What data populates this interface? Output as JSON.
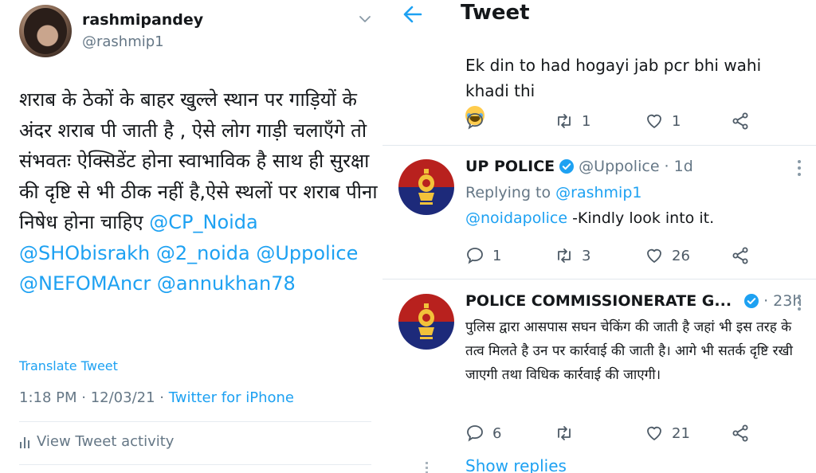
{
  "left_tweet": {
    "user": {
      "name": "rashmipandey",
      "handle": "@rashmip1"
    },
    "body_text": "शराब के ठेकों के बाहर खुल्ले स्थान पर गाड़ियों के अंदर शराब पी जाती है , ऐसे लोग गाड़ी चलाएँगे तो संभवतः ऐक्सिडेंट होना स्वाभाविक है साथ ही सुरक्षा की दृष्टि से भी ठीक नहीं है,ऐसे स्थलों पर शराब पीना निषेध होना चाहिए",
    "mentions": [
      "@CP_Noida",
      "@SHObisrakh",
      "@2_noida",
      "@Uppolice",
      "@NEFOMAncr",
      "@annukhan78"
    ],
    "translate_label": "Translate Tweet",
    "timestamp": "1:18 PM · 12/03/21 · ",
    "source": "Twitter for iPhone",
    "activity_label": "View Tweet activity"
  },
  "right_panel": {
    "header": {
      "title": "Tweet"
    },
    "tweet1": {
      "text": "Ek din to had hogayi jab pcr bhi wahi khadi thi",
      "emoji": "face-with-tears-of-joy",
      "reply_count": "",
      "retweet_count": "1",
      "like_count": "1"
    },
    "tweet2": {
      "name": "UP POLICE",
      "handle": "@Uppolice · 1d",
      "replying_prefix": "Replying to ",
      "replying_to": "@rashmip1",
      "body_mention": "@noidapolice",
      "body_text": " -Kindly look into it.",
      "reply_count": "1",
      "retweet_count": "3",
      "like_count": "26"
    },
    "tweet3": {
      "name": "POLICE COMMISSIONERATE G...",
      "handle": "· 23h",
      "body_text": "पुलिस द्वारा आसपास सघन चेकिंग की जाती है जहां भी इस तरह के तत्व मिलते है उन पर कार्रवाई की जाती है। आगे भी सतर्क दृष्टि रखी जाएगी तथा विधिक कार्रवाई की जाएगी।",
      "reply_count": "6",
      "retweet_count": "",
      "like_count": "21"
    },
    "show_replies_label": "Show replies"
  },
  "colors": {
    "accent": "#1da1f2",
    "text": "#14171a",
    "muted": "#657786"
  }
}
